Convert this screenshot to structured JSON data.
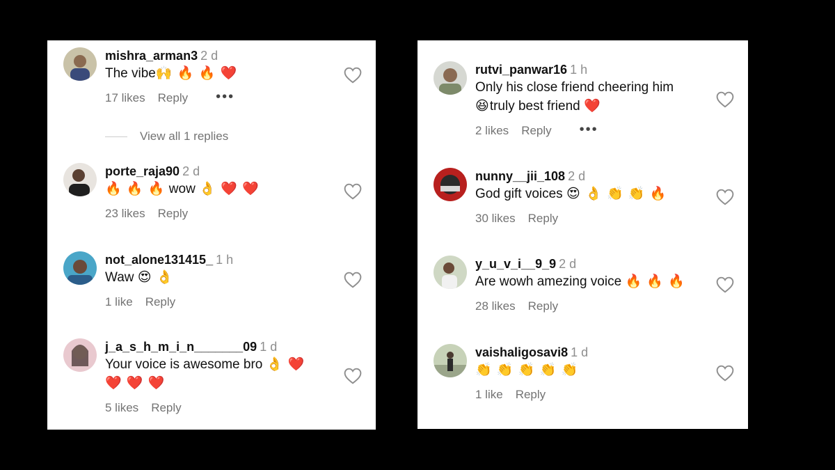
{
  "left_panel": {
    "comments": [
      {
        "username": "mishra_arman3",
        "time": "2 d",
        "text": "The vibe",
        "emojis": "🙌 🔥 🔥 ❤️",
        "likes": "17 likes",
        "reply": "Reply",
        "more": "•••",
        "view_replies": "View all 1 replies"
      },
      {
        "username": "porte_raja90",
        "time": "2 d",
        "emojis_pre": "🔥 🔥 🔥",
        "text": " wow ",
        "emojis": "👌 ❤️ ❤️",
        "likes": "23 likes",
        "reply": "Reply"
      },
      {
        "username": "not_alone131415_",
        "time": "1 h",
        "text": "Waw ",
        "emojis": "😍 👌",
        "likes": "1 like",
        "reply": "Reply"
      },
      {
        "username": "j_a_s_h_m_i_n_______09",
        "time": "1 d",
        "text": "Your voice is awesome bro ",
        "emojis": "👌 ❤️",
        "emojis_line2": "❤️ ❤️ ❤️",
        "likes": "5 likes",
        "reply": "Reply"
      }
    ]
  },
  "right_panel": {
    "comments": [
      {
        "username": "rutvi_panwar16",
        "time": "1 h",
        "text": "Only his close friend cheering him",
        "emojis_pre_line2": "😆",
        "text_line2": "truly best friend ",
        "emojis": "❤️",
        "likes": "2 likes",
        "reply": "Reply",
        "more": "•••"
      },
      {
        "username": "nunny__jii_108",
        "time": "2 d",
        "text": "God gift voices ",
        "emojis": "😍 👌 👏 👏 🔥",
        "likes": "30 likes",
        "reply": "Reply"
      },
      {
        "username": "y_u_v_i__9_9",
        "time": "2 d",
        "text": "Are wowh amezing voice ",
        "emojis": "🔥 🔥 🔥",
        "likes": "28 likes",
        "reply": "Reply"
      },
      {
        "username": "vaishaligosavi8",
        "time": "1 d",
        "emojis": "👏 👏 👏 👏 👏",
        "likes": "1 like",
        "reply": "Reply"
      }
    ]
  },
  "icons": {
    "heart": "heart-outline-icon",
    "more": "more-horizontal-icon"
  },
  "colors": {
    "background": "#000000",
    "panel": "#ffffff",
    "muted": "#737373",
    "text": "#111111"
  }
}
